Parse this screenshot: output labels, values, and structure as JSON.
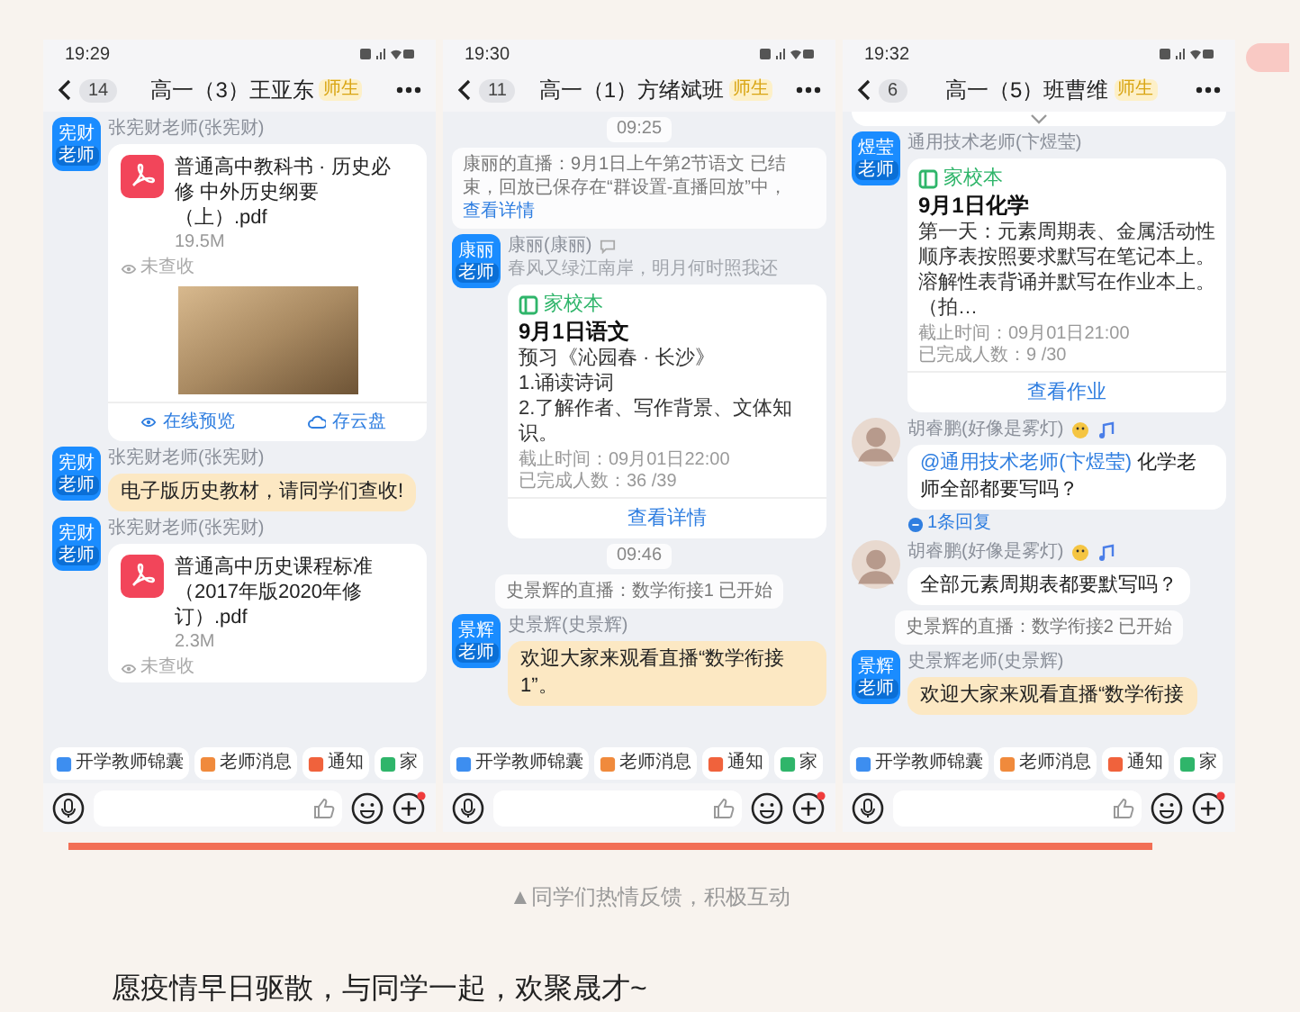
{
  "phones": [
    {
      "time": "19:29",
      "back_count": "14",
      "title": "高一（3）王亚东",
      "badge": "师生",
      "top_chevron": false,
      "messages": [
        {
          "kind": "file",
          "sender": "张宪财老师(张宪财)",
          "avatar": {
            "kind": "name",
            "name": "宪财",
            "role": "老师"
          },
          "title": "普通高中教科书 · 历史必修 中外历史纲要（上）.pdf",
          "size": "19.5M",
          "status": "未查收",
          "cover": true,
          "actions": [
            "在线预览",
            "存云盘"
          ]
        },
        {
          "kind": "text",
          "sender": "张宪财老师(张宪财)",
          "avatar": {
            "kind": "name",
            "name": "宪财",
            "role": "老师"
          },
          "highlighted": true,
          "name_icons": false,
          "text": "电子版历史教材，请同学们查收!"
        },
        {
          "kind": "file",
          "sender": "张宪财老师(张宪财)",
          "avatar": {
            "kind": "name",
            "name": "宪财",
            "role": "老师"
          },
          "title": "普通高中历史课程标准（2017年版2020年修订）.pdf",
          "size": "2.3M",
          "status": "未查收",
          "cover": false
        }
      ],
      "quick_actions": [
        {
          "label": "开学教师锦囊",
          "color": "#3d8ef0"
        },
        {
          "label": "老师消息",
          "color": "#f08a3c"
        },
        {
          "label": "通知",
          "color": "#f0623c"
        },
        {
          "label": "家",
          "color": "#2fb56a"
        }
      ]
    },
    {
      "time": "19:30",
      "back_count": "11",
      "title": "高一（1）方绪斌班",
      "badge": "师生",
      "top_chevron": false,
      "messages": [
        {
          "kind": "time",
          "text": "09:25"
        },
        {
          "kind": "system",
          "text": "康丽的直播：9月1日上午第2节语文 已结束，回放已保存在“群设置-直播回放”中，",
          "link": "查看详情"
        },
        {
          "kind": "homework",
          "sender": "康丽(康丽)",
          "quote": "春风又绿江南岸，明月何时照我还",
          "avatar": {
            "kind": "name",
            "name": "康丽",
            "role": "老师"
          },
          "app": "家校本",
          "title": "9月1日语文",
          "body": [
            "预习《沁园春 · 长沙》",
            "1.诵读诗词",
            "2.了解作者、写作背景、文体知识。"
          ],
          "deadline": "截止时间：09月01日22:00",
          "done": "已完成人数：36 /39",
          "button": "查看详情"
        },
        {
          "kind": "time",
          "text": "09:46"
        },
        {
          "kind": "system",
          "text": "史景辉的直播：数学衔接1 已开始"
        },
        {
          "kind": "text",
          "sender": "史景辉(史景辉)",
          "avatar": {
            "kind": "name",
            "name": "景辉",
            "role": "老师"
          },
          "highlighted": true,
          "name_icons": false,
          "text": "欢迎大家来观看直播“数学衔接1”。"
        }
      ],
      "quick_actions": [
        {
          "label": "开学教师锦囊",
          "color": "#3d8ef0"
        },
        {
          "label": "老师消息",
          "color": "#f08a3c"
        },
        {
          "label": "通知",
          "color": "#f0623c"
        },
        {
          "label": "家",
          "color": "#2fb56a"
        }
      ]
    },
    {
      "time": "19:32",
      "back_count": "6",
      "title": "高一（5）班曹维",
      "badge": "师生",
      "top_chevron": true,
      "messages": [
        {
          "kind": "homework",
          "sender": "通用技术老师(卞煜莹)",
          "avatar": {
            "kind": "name",
            "name": "煜莹",
            "role": "老师"
          },
          "app": "家校本",
          "title": "9月1日化学",
          "body": [
            "第一天：元素周期表、金属活动性顺序表按照要求默写在笔记本上。溶解性表背诵并默写在作业本上。（拍…"
          ],
          "deadline": "截止时间：09月01日21:00",
          "done": "已完成人数：9 /30",
          "button": "查看作业"
        },
        {
          "kind": "text",
          "sender": "胡睿鹏(好像是雾灯)",
          "avatar": {
            "kind": "cartoon"
          },
          "highlighted": false,
          "name_icons": true,
          "mention": "@通用技术老师(卞煜莹)",
          "text": "化学老师全部都要写吗？",
          "replies": "1条回复"
        },
        {
          "kind": "text",
          "sender": "胡睿鹏(好像是雾灯)",
          "avatar": {
            "kind": "cartoon"
          },
          "highlighted": false,
          "name_icons": true,
          "text": "全部元素周期表都要默写吗？"
        },
        {
          "kind": "system",
          "text": "史景辉的直播：数学衔接2 已开始"
        },
        {
          "kind": "text",
          "sender": "史景辉老师(史景辉)",
          "avatar": {
            "kind": "name",
            "name": "景辉",
            "role": "老师"
          },
          "highlighted": true,
          "name_icons": false,
          "text": "欢迎大家来观看直播“数学衔接"
        }
      ],
      "quick_actions": [
        {
          "label": "开学教师锦囊",
          "color": "#3d8ef0"
        },
        {
          "label": "老师消息",
          "color": "#f08a3c"
        },
        {
          "label": "通知",
          "color": "#f0623c"
        },
        {
          "label": "家",
          "color": "#2fb56a"
        }
      ]
    }
  ],
  "caption": "▲同学们热情反馈，积极互动",
  "body_text": "愿疫情早日驱散，与同学一起，欢聚晟才~"
}
